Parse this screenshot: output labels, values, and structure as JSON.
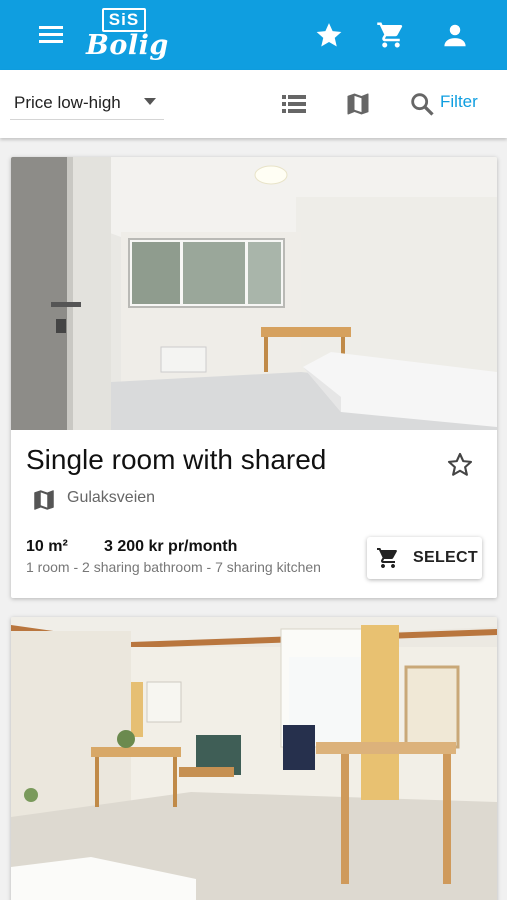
{
  "header": {
    "logo_top": "SiS",
    "logo_bottom": "Bolig",
    "icons": [
      "menu-icon",
      "star-icon",
      "cart-icon",
      "person-icon"
    ],
    "color": "#0f9ee0"
  },
  "toolbar": {
    "sort_value": "Price low-high",
    "filter_label": "Filter",
    "icons": [
      "list-view-icon",
      "map-view-icon",
      "search-icon"
    ]
  },
  "listings": [
    {
      "title": "Single room with shared",
      "location": "Gulaksveien",
      "size": "10 m²",
      "price": "3 200 kr pr/month",
      "details": "1 room - 2 sharing bathroom - 7 sharing kitchen",
      "select_label": "SELECT"
    },
    {
      "title": "",
      "location": ""
    }
  ]
}
